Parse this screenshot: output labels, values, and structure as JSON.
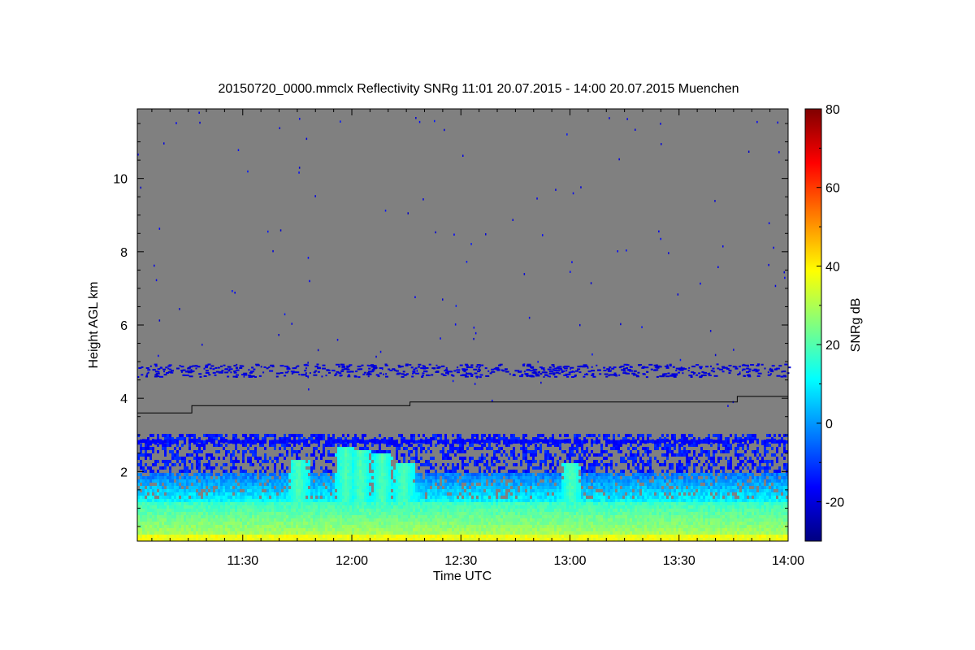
{
  "chart_data": {
    "type": "heatmap",
    "title": "20150720_0000.mmclx Reflectivity SNRg   11:01 20.07.2015 - 14:00 20.07.2015 Muenchen",
    "xlabel": "Time UTC",
    "ylabel": "Height AGL km",
    "colorbar_label": "SNRg dB",
    "x_range": [
      "11:01",
      "14:00"
    ],
    "x_ticks": [
      "11:30",
      "12:00",
      "12:30",
      "13:00",
      "13:30",
      "14:00"
    ],
    "y_range": [
      0.1,
      11.9
    ],
    "y_ticks": [
      2,
      4,
      6,
      8,
      10
    ],
    "colorbar_range": [
      -30,
      80
    ],
    "colorbar_ticks": [
      -20,
      0,
      20,
      40,
      60,
      80
    ],
    "colormap": [
      "#000080",
      "#0000ff",
      "#0080ff",
      "#00ffff",
      "#80ff80",
      "#ffff00",
      "#ff8000",
      "#ff0000",
      "#800000"
    ],
    "background_color": "#808080",
    "features": {
      "dense_echo_top_km": 2.9,
      "cloud_layer_km": [
        2.75,
        2.9
      ],
      "plumes": [
        {
          "time": "11:45",
          "top_km": 2.4
        },
        {
          "time": "11:58",
          "top_km": 2.7
        },
        {
          "time": "12:02",
          "top_km": 2.6
        },
        {
          "time": "12:08",
          "top_km": 2.5
        },
        {
          "time": "12:14",
          "top_km": 2.3
        },
        {
          "time": "13:00",
          "top_km": 2.3
        }
      ],
      "sparse_layer_km": [
        4.6,
        4.95
      ]
    },
    "boundary_line": [
      {
        "time": "11:01",
        "height_km": 3.6
      },
      {
        "time": "11:16",
        "height_km": 3.6
      },
      {
        "time": "11:16",
        "height_km": 3.8
      },
      {
        "time": "12:16",
        "height_km": 3.8
      },
      {
        "time": "12:16",
        "height_km": 3.9
      },
      {
        "time": "13:46",
        "height_km": 3.9
      },
      {
        "time": "13:46",
        "height_km": 4.05
      },
      {
        "time": "14:00",
        "height_km": 4.05
      }
    ]
  }
}
